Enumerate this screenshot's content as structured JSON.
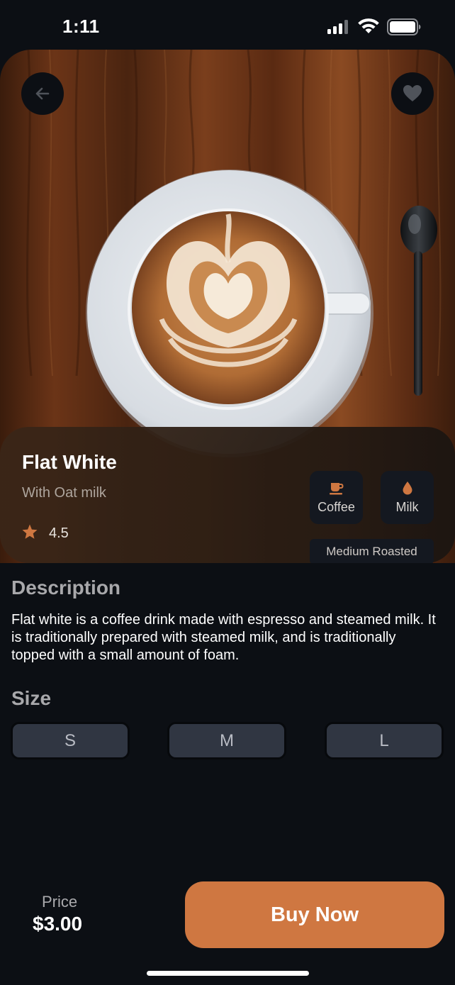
{
  "status_bar": {
    "time": "1:11"
  },
  "hero": {
    "back_icon": "arrow-left-icon",
    "favorite_icon": "heart-icon"
  },
  "product": {
    "name": "Flat White",
    "subtitle": "With Oat milk",
    "rating": "4.5",
    "chips": [
      {
        "label": "Coffee",
        "icon": "coffee-cup-icon"
      },
      {
        "label": "Milk",
        "icon": "milk-drop-icon"
      }
    ],
    "roast": "Medium Roasted"
  },
  "description": {
    "title": "Description",
    "text": "Flat white is a coffee drink made with espresso and steamed milk. It is traditionally prepared with steamed milk, and is traditionally topped with a small amount of foam."
  },
  "size": {
    "title": "Size",
    "options": [
      "S",
      "M",
      "L"
    ]
  },
  "footer": {
    "price_label": "Price",
    "price_value": "$3.00",
    "buy_label": "Buy Now"
  },
  "colors": {
    "accent": "#CF7741",
    "background": "#0C0F14",
    "chip_background": "#141820",
    "size_button": "#303642"
  }
}
